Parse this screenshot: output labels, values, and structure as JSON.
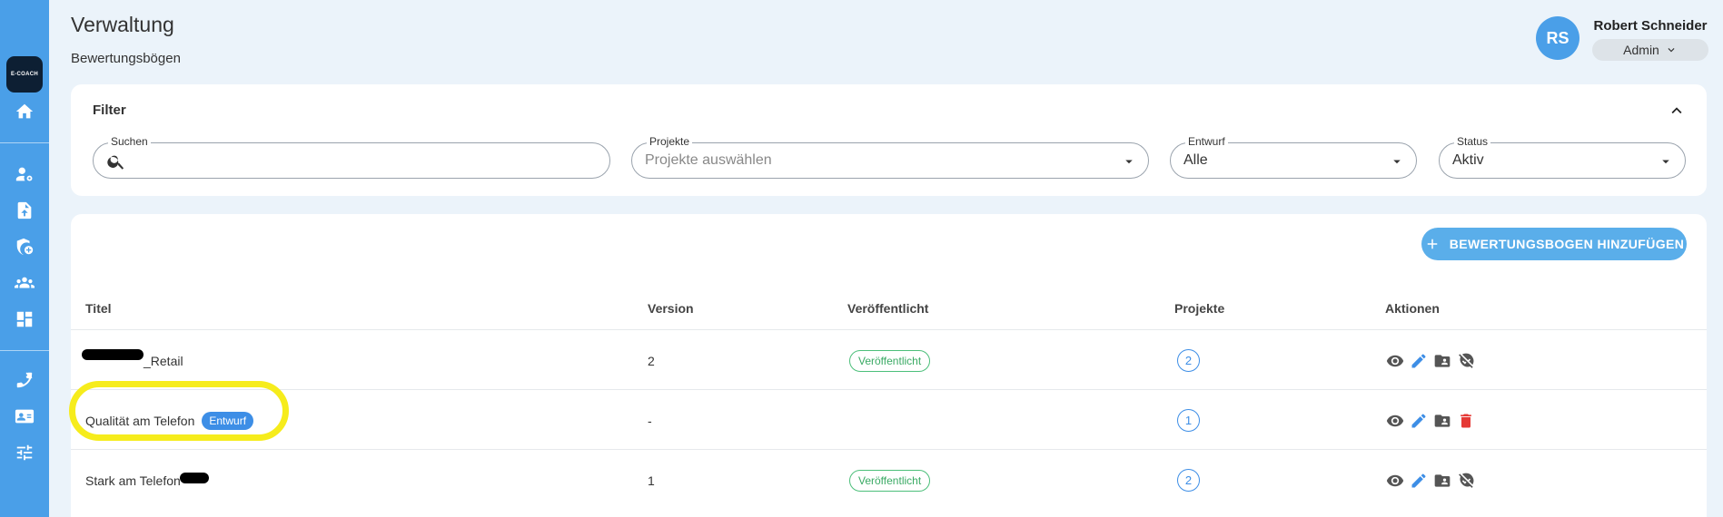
{
  "app": {
    "logo_text": "E-COACH"
  },
  "header": {
    "title": "Verwaltung",
    "subtitle": "Bewertungsbögen"
  },
  "user": {
    "initials": "RS",
    "name": "Robert Schneider",
    "role": "Admin"
  },
  "filter": {
    "title": "Filter",
    "search": {
      "label": "Suchen",
      "value": ""
    },
    "projects": {
      "label": "Projekte",
      "placeholder": "Projekte auswählen"
    },
    "draft": {
      "label": "Entwurf",
      "value": "Alle"
    },
    "status": {
      "label": "Status",
      "value": "Aktiv"
    }
  },
  "table": {
    "add_button": "BEWERTUNGSBOGEN HINZUFÜGEN",
    "headers": {
      "title": "Titel",
      "version": "Version",
      "published": "Veröffentlicht",
      "projects": "Projekte",
      "actions": "Aktionen"
    },
    "rows": [
      {
        "title": "_Retail",
        "draft_badge": "",
        "version": "2",
        "published": "Veröffentlicht",
        "projects": "2",
        "last_action": "unpublish"
      },
      {
        "title": "Qualität am Telefon",
        "draft_badge": "Entwurf",
        "version": "-",
        "published": "",
        "projects": "1",
        "last_action": "delete"
      },
      {
        "title": "Stark am Telefon",
        "draft_badge": "",
        "version": "1",
        "published": "Veröffentlicht",
        "projects": "2",
        "last_action": "unpublish"
      }
    ]
  },
  "colors": {
    "sidebar": "#4a9fe8",
    "accent": "#3d8ee6",
    "published": "#3aaa64",
    "delete": "#e53935",
    "highlight": "#f6ec1c"
  }
}
